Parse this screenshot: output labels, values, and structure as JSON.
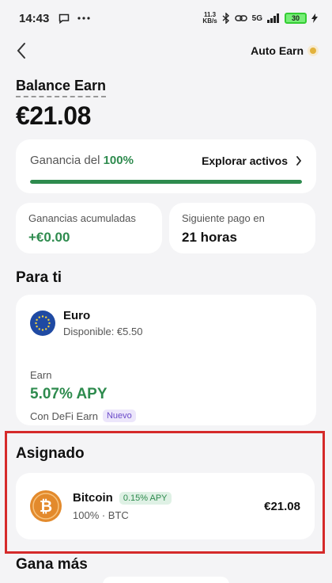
{
  "status_bar": {
    "time": "14:43",
    "net_speed_value": "11.3",
    "net_speed_unit": "KB/s",
    "network": "5G",
    "battery": "30"
  },
  "header": {
    "auto_earn_label": "Auto Earn"
  },
  "balance": {
    "label": "Balance Earn",
    "value": "€21.08"
  },
  "gain_card": {
    "prefix": "Ganancia del",
    "percent": "100%",
    "progress": 1.0,
    "explore_label": "Explorar activos"
  },
  "stats": {
    "accumulated_label": "Ganancias acumuladas",
    "accumulated_value": "+€0.00",
    "next_payment_label": "Siguiente pago en",
    "next_payment_value": "21 horas"
  },
  "for_you": {
    "title": "Para ti",
    "asset_name": "Euro",
    "available": "Disponible: €5.50",
    "earn_label": "Earn",
    "apy": "5.07% APY",
    "provider": "Con DeFi Earn",
    "badge": "Nuevo"
  },
  "assigned": {
    "title": "Asignado",
    "asset_name": "Bitcoin",
    "apy_badge": "0.15% APY",
    "allocation": "100% · BTC",
    "amount": "€21.08"
  },
  "earn_more": {
    "title": "Gana más"
  },
  "colors": {
    "accent_green": "#2e8b4e",
    "highlight_red": "#d52a2a",
    "bitcoin_orange": "#e38a2c",
    "euro_blue": "#1f4aa3"
  }
}
